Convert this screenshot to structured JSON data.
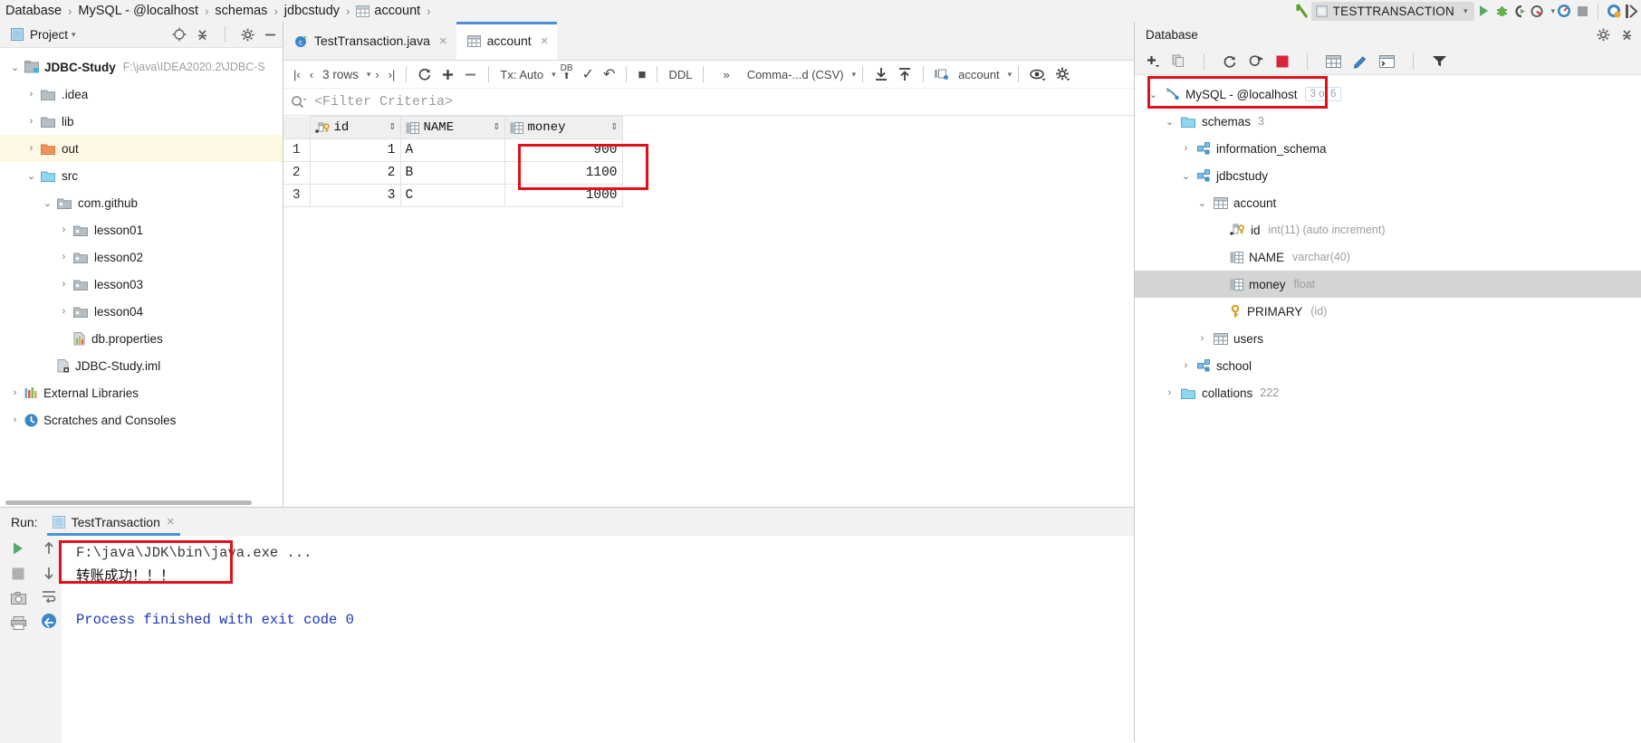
{
  "breadcrumb": {
    "items": [
      {
        "label": "Database",
        "icon": "none"
      },
      {
        "label": "MySQL - @localhost",
        "icon": "none"
      },
      {
        "label": "schemas",
        "icon": "none"
      },
      {
        "label": "jdbcstudy",
        "icon": "none"
      },
      {
        "label": "account",
        "icon": "table-icon"
      }
    ],
    "separator": "›"
  },
  "run_widget": {
    "config_name": "TESTTRANSACTION",
    "dropdown_caret": "▾",
    "buttons": [
      "run-button",
      "debug-button",
      "run-coverage-button",
      "profiler-button",
      "stop-button",
      "updates-button",
      "search-everywhere-button"
    ]
  },
  "project_panel": {
    "title": "Project",
    "title_caret": "▾",
    "actions": [
      "locate-icon",
      "collapse-all-icon",
      "settings-gear-icon",
      "hide-icon"
    ],
    "tree": [
      {
        "label": "JDBC-Study",
        "sub": "F:\\java\\IDEA2020.2\\JDBC-S",
        "depth": 0,
        "arrow": "⌄",
        "icon": "project-module-icon",
        "bold": true,
        "selected": false
      },
      {
        "label": ".idea",
        "sub": "",
        "depth": 1,
        "arrow": "›",
        "icon": "folder-icon",
        "bold": false,
        "selected": false
      },
      {
        "label": "lib",
        "sub": "",
        "depth": 1,
        "arrow": "›",
        "icon": "folder-icon",
        "bold": false,
        "selected": false
      },
      {
        "label": "out",
        "sub": "",
        "depth": 1,
        "arrow": "›",
        "icon": "folder-orange-icon",
        "bold": false,
        "selected": true
      },
      {
        "label": "src",
        "sub": "",
        "depth": 1,
        "arrow": "⌄",
        "icon": "folder-blue-icon",
        "bold": false,
        "selected": false
      },
      {
        "label": "com.github",
        "sub": "",
        "depth": 2,
        "arrow": "⌄",
        "icon": "package-icon",
        "bold": false,
        "selected": false
      },
      {
        "label": "lesson01",
        "sub": "",
        "depth": 3,
        "arrow": "›",
        "icon": "package-icon",
        "bold": false,
        "selected": false
      },
      {
        "label": "lesson02",
        "sub": "",
        "depth": 3,
        "arrow": "›",
        "icon": "package-icon",
        "bold": false,
        "selected": false
      },
      {
        "label": "lesson03",
        "sub": "",
        "depth": 3,
        "arrow": "›",
        "icon": "package-icon",
        "bold": false,
        "selected": false
      },
      {
        "label": "lesson04",
        "sub": "",
        "depth": 3,
        "arrow": "›",
        "icon": "package-icon",
        "bold": false,
        "selected": false
      },
      {
        "label": "db.properties",
        "sub": "",
        "depth": 3,
        "arrow": "",
        "icon": "properties-file-icon",
        "bold": false,
        "selected": false
      },
      {
        "label": "JDBC-Study.iml",
        "sub": "",
        "depth": 2,
        "arrow": "",
        "icon": "iml-file-icon",
        "bold": false,
        "selected": false
      },
      {
        "label": "External Libraries",
        "sub": "",
        "depth": 0,
        "arrow": "›",
        "icon": "libraries-icon",
        "bold": false,
        "selected": false
      },
      {
        "label": "Scratches and Consoles",
        "sub": "",
        "depth": 0,
        "arrow": "›",
        "icon": "scratches-icon",
        "bold": false,
        "selected": false
      }
    ]
  },
  "editor": {
    "tabs": [
      {
        "label": "TestTransaction.java",
        "icon": "java-class-icon",
        "active": false,
        "close": "×"
      },
      {
        "label": "account",
        "icon": "table-icon",
        "active": true,
        "close": "×"
      }
    ]
  },
  "db_toolbar": {
    "first_page": "|‹",
    "prev_page": "‹",
    "rows_label": "3 rows",
    "next_page": "›",
    "last_page": "›|",
    "reload": "refresh-icon",
    "add_row": "+",
    "remove_row": "−",
    "tx_label": "Tx: Auto",
    "submit_db": "DB",
    "commit": "✓",
    "rollback": "↶",
    "cancel": "■",
    "ddl_label": "DDL",
    "more": "»",
    "format_label": "Comma-...d (CSV)",
    "download": "download-icon",
    "upload": "upload-icon",
    "table_selector": "account",
    "view_options": "eye-icon",
    "settings": "gear-icon"
  },
  "filter": {
    "icon": "search-icon",
    "placeholder": "<Filter Criteria>"
  },
  "grid": {
    "columns": [
      {
        "name": "id",
        "icon": "primary-key-column-icon",
        "sortable": true
      },
      {
        "name": "NAME",
        "icon": "column-icon",
        "sortable": true
      },
      {
        "name": "money",
        "icon": "column-icon",
        "sortable": true
      }
    ],
    "rows": [
      {
        "num": "1",
        "id": "1",
        "NAME": "A",
        "money": "900"
      },
      {
        "num": "2",
        "id": "2",
        "NAME": "B",
        "money": "1100"
      },
      {
        "num": "3",
        "id": "3",
        "NAME": "C",
        "money": "1000"
      }
    ],
    "highlight_note": "red-box-around-money-900-and-1100"
  },
  "database_panel": {
    "title": "Database",
    "header_actions": [
      "settings-gear-icon",
      "collapse-all-icon"
    ],
    "toolbar": [
      "add-icon",
      "copy-icon",
      "refresh-icon",
      "run-sql-icon",
      "stop-icon",
      "table-icon",
      "edit-icon",
      "jump-to-console-icon",
      "filter-icon"
    ],
    "tree": [
      {
        "label": "MySQL - @localhost",
        "arrow": "⌄",
        "icon": "mysql-datasource-icon",
        "depth": 0,
        "badge": "3 of 6",
        "type": "",
        "count": "",
        "selected": false,
        "highlight": true
      },
      {
        "label": "schemas",
        "arrow": "⌄",
        "icon": "folder-blue-icon",
        "depth": 1,
        "badge": "",
        "type": "",
        "count": "3",
        "selected": false,
        "highlight": false
      },
      {
        "label": "information_schema",
        "arrow": "›",
        "icon": "schema-icon",
        "depth": 2,
        "badge": "",
        "type": "",
        "count": "",
        "selected": false,
        "highlight": false
      },
      {
        "label": "jdbcstudy",
        "arrow": "⌄",
        "icon": "schema-icon",
        "depth": 2,
        "badge": "",
        "type": "",
        "count": "",
        "selected": false,
        "highlight": false
      },
      {
        "label": "account",
        "arrow": "⌄",
        "icon": "table-icon",
        "depth": 3,
        "badge": "",
        "type": "",
        "count": "",
        "selected": false,
        "highlight": false
      },
      {
        "label": "id",
        "arrow": "",
        "icon": "primary-key-column-icon",
        "depth": 4,
        "badge": "",
        "type": "int(11) (auto increment)",
        "count": "",
        "selected": false,
        "highlight": false
      },
      {
        "label": "NAME",
        "arrow": "",
        "icon": "column-icon",
        "depth": 4,
        "badge": "",
        "type": "varchar(40)",
        "count": "",
        "selected": false,
        "highlight": false
      },
      {
        "label": "money",
        "arrow": "",
        "icon": "column-icon",
        "depth": 4,
        "badge": "",
        "type": "float",
        "count": "",
        "selected": true,
        "highlight": false
      },
      {
        "label": "PRIMARY",
        "arrow": "",
        "icon": "key-icon",
        "depth": 4,
        "badge": "",
        "type": "(id)",
        "count": "",
        "selected": false,
        "highlight": false
      },
      {
        "label": "users",
        "arrow": "›",
        "icon": "table-icon",
        "depth": 3,
        "badge": "",
        "type": "",
        "count": "",
        "selected": false,
        "highlight": false
      },
      {
        "label": "school",
        "arrow": "›",
        "icon": "schema-icon",
        "depth": 2,
        "badge": "",
        "type": "",
        "count": "",
        "selected": false,
        "highlight": false
      },
      {
        "label": "collations",
        "arrow": "›",
        "icon": "folder-blue-icon",
        "depth": 1,
        "badge": "",
        "type": "",
        "count": "222",
        "selected": false,
        "highlight": false
      }
    ]
  },
  "run_panel": {
    "label": "Run:",
    "tab_label": "TestTransaction",
    "tab_close": "×",
    "gutter_buttons": [
      "rerun-icon",
      "stop-icon",
      "screenshot-icon",
      "print-icon"
    ],
    "gutter2_buttons": [
      "scroll-up-icon",
      "scroll-down-icon",
      "soft-wrap-icon",
      "toggle-icon"
    ],
    "console": {
      "command_line": "F:\\java\\JDK\\bin\\java.exe ...",
      "output_line": "转账成功！！！",
      "exit_line": "Process finished with exit code 0"
    }
  },
  "colors": {
    "accent_blue": "#4a90d9",
    "annotation_red": "#e3101a",
    "selection_yellow": "#fdf8e3",
    "selection_gray": "#d4d4d4",
    "panel_gray": "#f2f2f2",
    "console_blue": "#1a36b8"
  }
}
